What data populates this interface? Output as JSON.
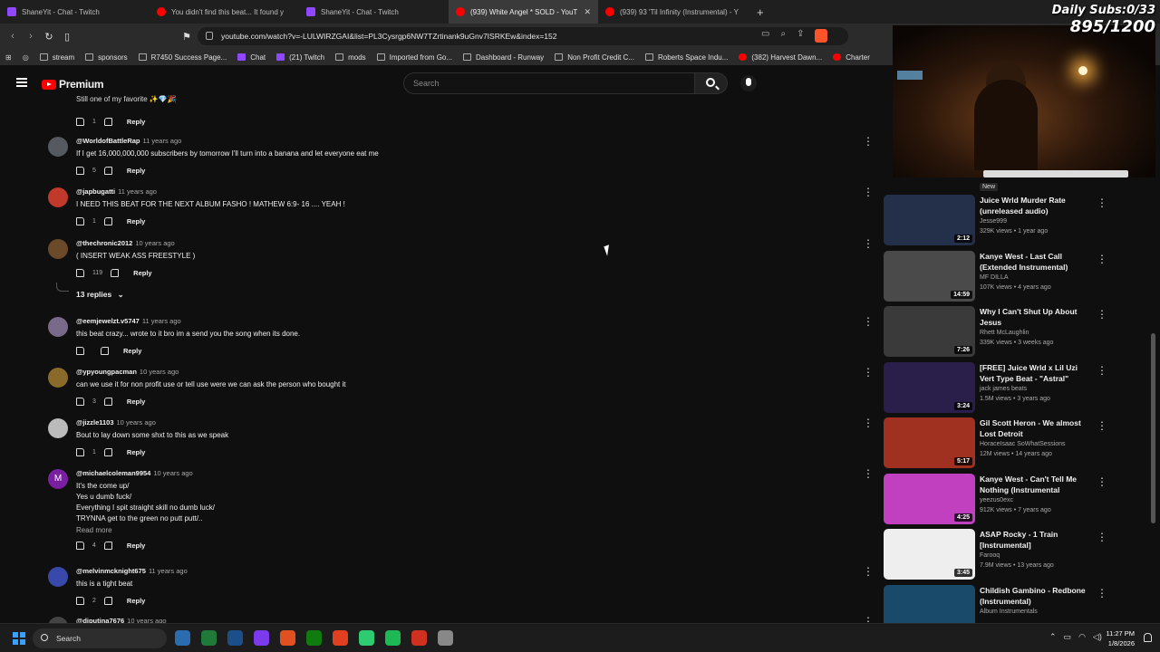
{
  "browser": {
    "tabs": [
      {
        "title": "ShaneYit - Chat - Twitch",
        "type": "twitch",
        "active": false
      },
      {
        "title": "You didn't find this beat... It found y",
        "type": "yt",
        "active": false
      },
      {
        "title": "ShaneYit - Chat - Twitch",
        "type": "twitch",
        "active": false
      },
      {
        "title": "(939) White Angel * SOLD - YouT",
        "type": "yt",
        "active": true
      },
      {
        "title": "(939) 93 'Til Infinity (Instrumental) - Y",
        "type": "yt",
        "active": false
      }
    ],
    "new_tab": "+",
    "url": "youtube.com/watch?v=-LULWIRZGAI&list=PL3Cysrgp6NW7TZrtinank9uGnv7ISRKEw&index=152",
    "bookmarks": [
      {
        "label": "stream",
        "icon": "folder"
      },
      {
        "label": "sponsors",
        "icon": "folder"
      },
      {
        "label": "R7450 Success Page...",
        "icon": "n-logo"
      },
      {
        "label": "Chat",
        "icon": "twitch"
      },
      {
        "label": "(21) Twitch",
        "icon": "twitch"
      },
      {
        "label": "mods",
        "icon": "folder"
      },
      {
        "label": "Imported from Go...",
        "icon": "folder"
      },
      {
        "label": "Dashboard - Runway",
        "icon": "runway"
      },
      {
        "label": "Non Profit Credit C...",
        "icon": "card"
      },
      {
        "label": "Roberts Space Indu...",
        "icon": "rsi"
      },
      {
        "label": "(382) Harvest Dawn...",
        "icon": "yt"
      },
      {
        "label": "Charter",
        "icon": "yt"
      }
    ]
  },
  "youtube": {
    "logo_text": "Premium",
    "search_placeholder": "Search"
  },
  "comments": {
    "fragment_text": "Still one of my favorite ✨💎🎉",
    "fragment_likes": "1",
    "reply_label": "Reply",
    "items": [
      {
        "handle": "@WorldofBattleRap",
        "time": "11 years ago",
        "lines": [
          "If I get 16,000,000,000 subscribers by tomorrow I'll turn into a banana and let everyone eat me"
        ],
        "likes": "5",
        "avatar": "#555a60"
      },
      {
        "handle": "@japbugatti",
        "time": "11 years ago",
        "lines": [
          "I NEED THIS BEAT FOR THE NEXT ALBUM FASHO !  MATHEW 6:9- 16  .... YEAH !"
        ],
        "likes": "1",
        "avatar": "#c0392b"
      },
      {
        "handle": "@thechronic2012",
        "time": "10 years ago",
        "lines": [
          "( INSERT WEAK ASS FREESTYLE )"
        ],
        "likes": "119",
        "avatar": "#6b4a2a"
      },
      {
        "handle": "@eemjewelzt.v5747",
        "time": "11 years ago",
        "lines": [
          "this beat crazy... wrote to it bro im a send you the song when its done."
        ],
        "likes": "",
        "avatar": "#7a6a8a"
      },
      {
        "handle": "@ypyoungpacman",
        "time": "10 years ago",
        "lines": [
          "can we use it for non profit use or tell use were we can ask the person who bought it"
        ],
        "likes": "3",
        "avatar": "#8a6a2a"
      },
      {
        "handle": "@jizzle1103",
        "time": "10 years ago",
        "lines": [
          "Bout to lay down some shxt to this as we speak"
        ],
        "likes": "1",
        "avatar": "#bbbbbb"
      },
      {
        "handle": "@michaelcoleman9954",
        "time": "10 years ago",
        "lines": [
          "It's the come up/",
          "Yes u dumb fuck/",
          "Everything I spit straight skill no dumb luck/",
          "TRYNNA get to the green no putt putt/.."
        ],
        "likes": "4",
        "avatar": "#7b1fa2",
        "initial": "M",
        "read_more": "Read more"
      },
      {
        "handle": "@melvinmcknight675",
        "time": "11 years ago",
        "lines": [
          "this is a tight beat"
        ],
        "likes": "2",
        "avatar": "#3949ab"
      },
      {
        "handle": "@djputina7676",
        "time": "10 years ago",
        "lines": [],
        "likes": "",
        "avatar": "#444444"
      }
    ],
    "replies_toggle": "13 replies"
  },
  "sidebar": {
    "new_badge": "New",
    "recs": [
      {
        "title": "Juice Wrld Murder Rate (unreleased audio)",
        "channel": "Jesse999",
        "meta": "329K views • 1 year ago",
        "duration": "2:12",
        "thumb": "#24304a"
      },
      {
        "title": "Kanye West - Last Call (Extended Instrumental)",
        "channel": "MF DILLA",
        "meta": "107K views • 4 years ago",
        "duration": "14:59",
        "thumb": "#4a4a4a"
      },
      {
        "title": "Why I Can't Shut Up About Jesus",
        "channel": "Rhett McLaughlin",
        "meta": "339K views • 3 weeks ago",
        "duration": "7:26",
        "thumb": "#3a3a3a"
      },
      {
        "title": "[FREE] Juice Wrld x Lil Uzi Vert Type Beat - \"Astral\"",
        "channel": "jack james beats",
        "meta": "1.5M views • 3 years ago",
        "duration": "3:24",
        "thumb": "#2a1f4a"
      },
      {
        "title": "Gil Scott Heron - We almost Lost Detroit",
        "channel": "HoraceIsaac SoWhatSessions",
        "meta": "12M views • 14 years ago",
        "duration": "5:17",
        "thumb": "#a03020"
      },
      {
        "title": "Kanye West - Can't Tell Me Nothing (Instrumental",
        "channel": "yeezus0exc",
        "meta": "912K views • 7 years ago",
        "duration": "4:25",
        "thumb": "#c040c0"
      },
      {
        "title": "ASAP Rocky - 1 Train [Instrumental]",
        "channel": "Farooq",
        "meta": "7.9M views • 13 years ago",
        "duration": "3:45",
        "thumb": "#eeeeee"
      },
      {
        "title": "Childish Gambino - Redbone (Instrumental)",
        "channel": "Album Instrumentals",
        "meta": "",
        "duration": "",
        "thumb": "#1a4a6a"
      }
    ]
  },
  "overlay": {
    "line1": "Daily Subs:0/33",
    "line2": "895/1200"
  },
  "taskbar": {
    "search_label": "Search",
    "time": "11:27 PM",
    "date": "1/8/2026",
    "apps": [
      "#2b6cb0",
      "#1f7a3a",
      "#1b4f8a",
      "#7c3aed",
      "#e05020",
      "#107c10",
      "#e04020",
      "#2ecc71",
      "#1db954",
      "#d03020",
      "#888888"
    ]
  }
}
